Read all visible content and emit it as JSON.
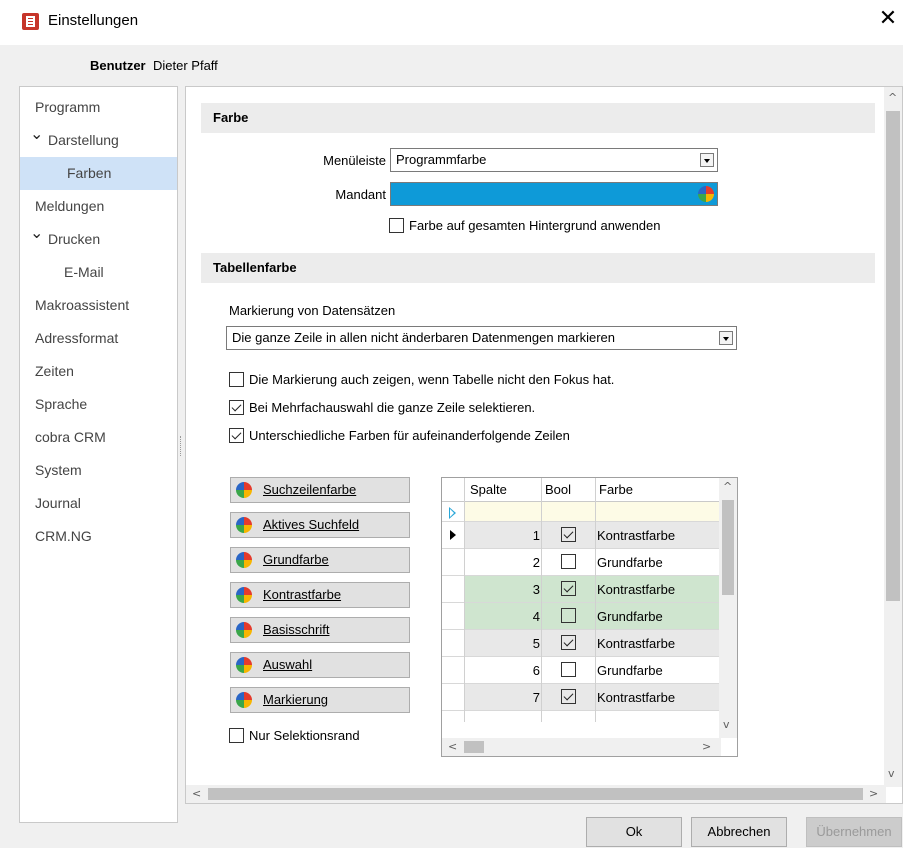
{
  "window": {
    "title": "Einstellungen",
    "close_glyph": "✕"
  },
  "user": {
    "label": "Benutzer",
    "name": "Dieter Pfaff"
  },
  "nav": [
    {
      "label": "Programm"
    },
    {
      "label": "Darstellung",
      "expanded": true
    },
    {
      "label": "Farben",
      "selected": true
    },
    {
      "label": "Meldungen"
    },
    {
      "label": "Drucken",
      "expanded": true
    },
    {
      "label": "E-Mail"
    },
    {
      "label": "Makroassistent"
    },
    {
      "label": "Adressformat"
    },
    {
      "label": "Zeiten"
    },
    {
      "label": "Sprache"
    },
    {
      "label": "cobra CRM"
    },
    {
      "label": "System"
    },
    {
      "label": "Journal"
    },
    {
      "label": "CRM.NG"
    }
  ],
  "farbe": {
    "header": "Farbe",
    "menuleiste_label": "Menüleiste",
    "menuleiste_value": "Programmfarbe",
    "mandant_label": "Mandant",
    "mandant_color": "#0e9ad8",
    "hintergrund_label": "Farbe auf gesamten Hintergrund anwenden",
    "hintergrund_checked": false
  },
  "tabellenfarbe": {
    "header": "Tabellenfarbe",
    "markierung_label": "Markierung von Datensätzen",
    "markierung_value": "Die ganze Zeile in allen nicht änderbaren Datenmengen markieren",
    "opt_fokus_label": "Die Markierung auch zeigen, wenn Tabelle nicht den Fokus hat.",
    "opt_fokus_checked": false,
    "opt_mehrfach_label": "Bei Mehrfachauswahl die ganze Zeile selektieren.",
    "opt_mehrfach_checked": true,
    "opt_farben_label": "Unterschiedliche Farben für aufeinanderfolgende Zeilen",
    "opt_farben_checked": true
  },
  "color_buttons": [
    {
      "label": "Suchzeilenfarbe"
    },
    {
      "label": "Aktives Suchfeld"
    },
    {
      "label": "Grundfarbe"
    },
    {
      "label": "Kontrastfarbe"
    },
    {
      "label": "Basisschrift"
    },
    {
      "label": "Auswahl"
    },
    {
      "label": "Markierung"
    }
  ],
  "nur_selektionsrand": {
    "label": "Nur Selektionsrand",
    "checked": false
  },
  "preview_grid": {
    "columns": [
      "Spalte",
      "Bool",
      "Farbe"
    ],
    "rows": [
      {
        "spalte": "",
        "bool": null,
        "farbe": "",
        "bg": "#fdfbe6",
        "indicator": "new"
      },
      {
        "spalte": "1",
        "bool": true,
        "farbe": "Kontrastfarbe",
        "bg": "#e8e8e8",
        "indicator": "current"
      },
      {
        "spalte": "2",
        "bool": false,
        "farbe": "Grundfarbe",
        "bg": "#ffffff",
        "indicator": ""
      },
      {
        "spalte": "3",
        "bool": true,
        "farbe": "Kontrastfarbe",
        "bg": "#cfe5cf",
        "indicator": ""
      },
      {
        "spalte": "4",
        "bool": false,
        "farbe": "Grundfarbe",
        "bg": "#cfe5cf",
        "indicator": ""
      },
      {
        "spalte": "5",
        "bool": true,
        "farbe": "Kontrastfarbe",
        "bg": "#e8e8e8",
        "indicator": ""
      },
      {
        "spalte": "6",
        "bool": false,
        "farbe": "Grundfarbe",
        "bg": "#ffffff",
        "indicator": ""
      },
      {
        "spalte": "7",
        "bool": true,
        "farbe": "Kontrastfarbe",
        "bg": "#e8e8e8",
        "indicator": ""
      }
    ]
  },
  "buttons": {
    "ok": "Ok",
    "cancel": "Abbrechen",
    "apply": "Übernehmen"
  }
}
